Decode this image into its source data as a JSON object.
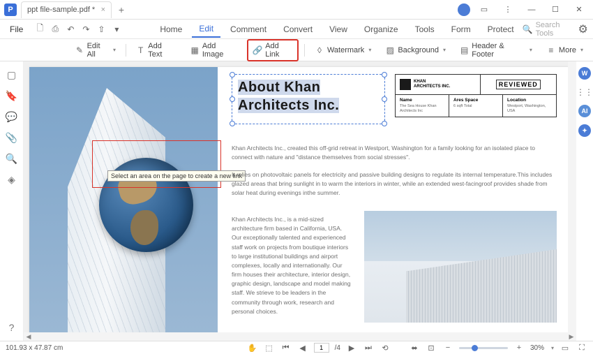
{
  "app": {
    "icon_letter": "P"
  },
  "tab": {
    "title": "ppt file-sample.pdf *"
  },
  "menu": {
    "file": "File"
  },
  "main_tabs": {
    "home": "Home",
    "edit": "Edit",
    "comment": "Comment",
    "convert": "Convert",
    "view": "View",
    "organize": "Organize",
    "tools": "Tools",
    "form": "Form",
    "protect": "Protect"
  },
  "search": {
    "placeholder": "Search Tools"
  },
  "toolbar": {
    "edit_all": "Edit All",
    "add_text": "Add Text",
    "add_image": "Add Image",
    "add_link": "Add Link",
    "watermark": "Watermark",
    "background": "Background",
    "header_footer": "Header & Footer",
    "more": "More"
  },
  "doc": {
    "title_line1": "About Khan",
    "title_line2": "Architects Inc.",
    "tooltip": "Select an area on the page to create a new link",
    "khan_label": "KHAN",
    "khan_sub": "ARCHITECTS INC.",
    "reviewed": "REVIEWED",
    "col1_label": "Name",
    "col1_val": "The Sea House Khan Architects Inc",
    "col2_label": "Ares Space",
    "col2_val": "6 sqft Total",
    "col3_label": "Location",
    "col3_val": "Westport, Washington, USA",
    "p1": "Khan Architects Inc., created this off-grid retreat in Westport, Washington for a family looking for an isolated place to connect with nature and \"distance themselves from social stresses\".",
    "p2": "It relies on photovoltaic panels for electricity and passive building designs to regulate its internal temperature.This includes glazed areas that bring sunlight in to warm the interiors in winter, while an extended west-facingroof provides shade from solar heat during evenings inthe summer.",
    "p3": "Khan Architects Inc., is a mid-sized architecture firm based in California, USA. Our exceptionally talented and experienced staff work on projects from boutique interiors to large institutional buildings and airport complexes, locally and internationally. Our firm houses their architecture, interior design, graphic design, landscape and model making staff. We strieve to be leaders in the community through work, research and personal choices."
  },
  "status": {
    "coords": "101.93 x 47.87 cm",
    "page_current": "1",
    "page_total": "/4",
    "zoom": "30%"
  }
}
